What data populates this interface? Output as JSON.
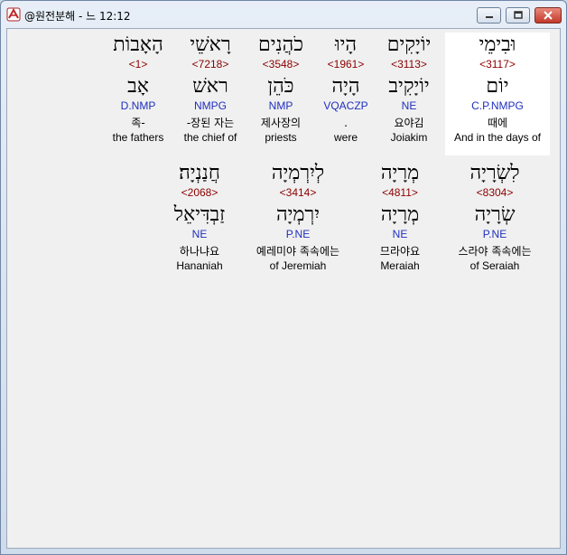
{
  "window": {
    "title": "@원전분해 - 느 12:12",
    "min_label": "‒",
    "max_label": "▭",
    "close_label": "✕"
  },
  "rows": [
    {
      "words": [
        {
          "heb": "וּבִימֵי",
          "strong": "<3117>",
          "lemma": "יוֹם",
          "morph": "C.P.NMPG",
          "kor": "때에",
          "eng": "And in the days of",
          "highlight": true
        },
        {
          "heb": "יוֹיָקִים",
          "strong": "<3113>",
          "lemma": "יוֹיָקִיב",
          "morph": "NE",
          "kor": "요야김",
          "eng": "Joiakim",
          "highlight": false
        },
        {
          "heb": "הָיוּ",
          "strong": "<1961>",
          "lemma": "הָיָה",
          "morph": "VQACZP",
          "kor": ".",
          "eng": "were",
          "highlight": false
        },
        {
          "heb": "כֹהֲנִים",
          "strong": "<3548>",
          "lemma": "כֹּהֵן",
          "morph": "NMP",
          "kor": "제사장의",
          "eng": "priests",
          "highlight": false
        },
        {
          "heb": "רָאשֵׁי",
          "strong": "<7218>",
          "lemma": "ראשׁ",
          "morph": "NMPG",
          "kor": "-장된 자는",
          "eng": "the chief of",
          "highlight": false
        },
        {
          "heb": "הָאָבוֹת",
          "strong": "<1>",
          "lemma": "אָב",
          "morph": "D.NMP",
          "kor": "족-",
          "eng": "the fathers",
          "highlight": false
        }
      ]
    },
    {
      "words": [
        {
          "heb": "לִשְׂרָיָה",
          "strong": "<8304>",
          "lemma": "שְׂרָיָה",
          "morph": "P.NE",
          "kor": "스라야 족속에는",
          "eng": "of Seraiah",
          "highlight": false
        },
        {
          "heb": "מְרָיָה",
          "strong": "<4811>",
          "lemma": "מְרָיָה",
          "morph": "NE",
          "kor": "므라야요",
          "eng": "Meraiah",
          "highlight": false
        },
        {
          "heb": "לְיִרְמְיָה",
          "strong": "<3414>",
          "lemma": "יִרְמְיָה",
          "morph": "P.NE",
          "kor": "예레미야 족속에는",
          "eng": "of Jeremiah",
          "highlight": false
        },
        {
          "heb": "חֲנַנְיָה׃",
          "strong": "<2068>",
          "lemma": "זַבְדִּיאֵל",
          "morph": "NE",
          "kor": "하나냐요",
          "eng": "Hananiah",
          "highlight": false
        }
      ]
    }
  ]
}
